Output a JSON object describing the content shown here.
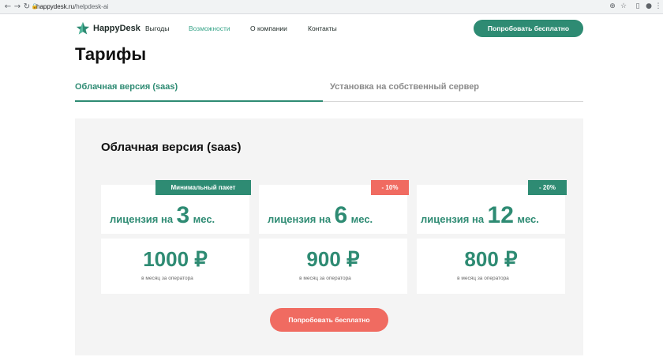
{
  "browser": {
    "url_host": "happydesk.ru",
    "url_path": "/helpdesk-ai",
    "back_icon": "arrow-left",
    "forward_icon": "arrow-right",
    "reload_icon": "reload",
    "lock_icon": "lock"
  },
  "header": {
    "logo_text": "HappyDesk",
    "nav": [
      {
        "label": "Выгоды",
        "active": false
      },
      {
        "label": "Возможности",
        "active": true
      },
      {
        "label": "О компании",
        "active": false
      },
      {
        "label": "Контакты",
        "active": false
      }
    ],
    "cta_label": "Попробовать бесплатно"
  },
  "page_title": "Тарифы",
  "tabs": [
    {
      "label": "Облачная версия (saas)",
      "active": true
    },
    {
      "label": "Установка на собственный сервер",
      "active": false
    }
  ],
  "panel": {
    "title": "Облачная версия (saas)",
    "plans": [
      {
        "badge": "Минимальный пакет",
        "badge_color": "#2e8b73",
        "prefix": "лицензия на",
        "months": "3",
        "suffix": "мес.",
        "price": "1000 ₽",
        "per": "в месяц за оператора"
      },
      {
        "badge": "- 10%",
        "badge_color": "#f06b61",
        "prefix": "лицензия на",
        "months": "6",
        "suffix": "мес.",
        "price": "900 ₽",
        "per": "в месяц за оператора"
      },
      {
        "badge": "- 20%",
        "badge_color": "#2e8b73",
        "prefix": "лицензия на",
        "months": "12",
        "suffix": "мес.",
        "price": "800 ₽",
        "per": "в месяц за оператора"
      }
    ],
    "cta_label": "Попробовать бесплатно"
  },
  "colors": {
    "accent_green": "#2e8b73",
    "accent_red": "#f06b61",
    "panel_bg": "#f4f4f4"
  }
}
